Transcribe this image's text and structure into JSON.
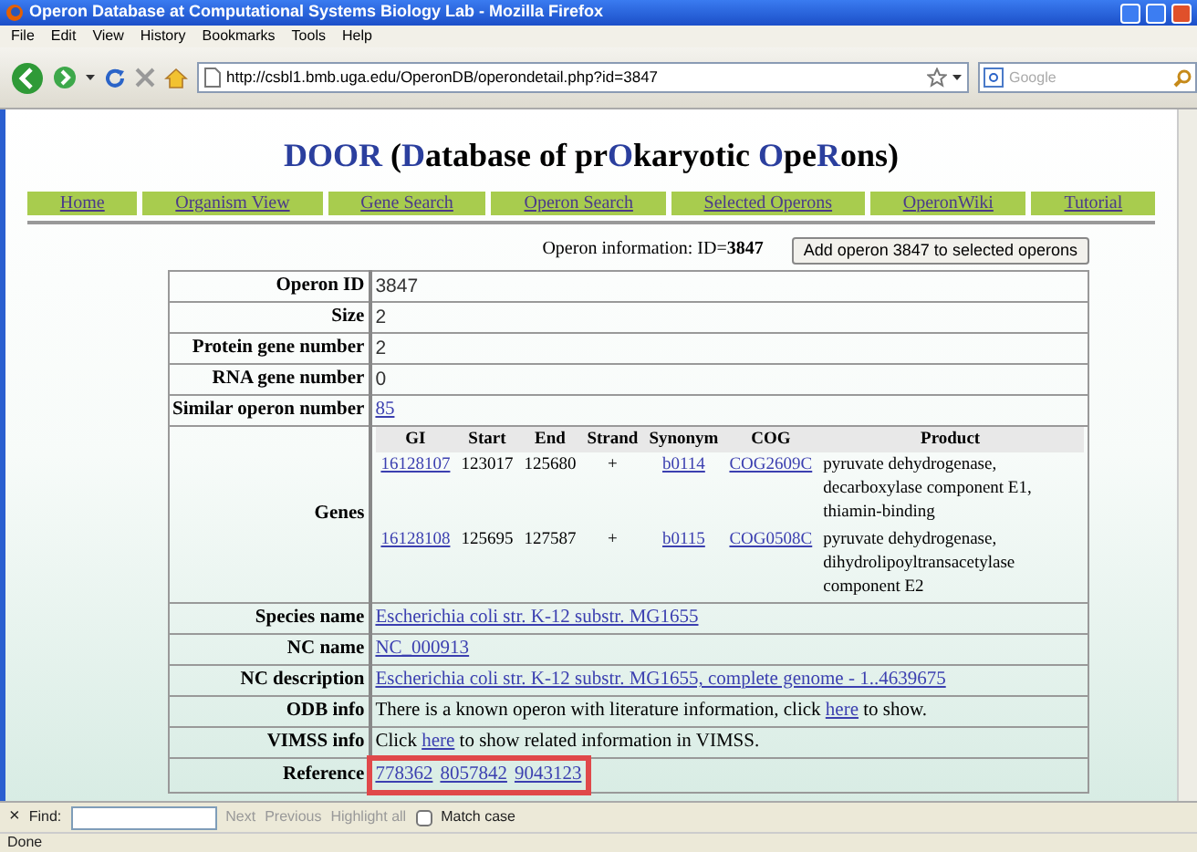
{
  "window": {
    "title": "Operon Database at Computational Systems Biology Lab - Mozilla Firefox"
  },
  "menu": [
    "File",
    "Edit",
    "View",
    "History",
    "Bookmarks",
    "Tools",
    "Help"
  ],
  "address": {
    "value": "http://csbl1.bmb.uga.edu/OperonDB/operondetail.php?id=3847"
  },
  "search": {
    "placeholder": "Google"
  },
  "heading": [
    {
      "text": "DOOR",
      "accent": true
    },
    {
      "text": " (",
      "accent": false
    },
    {
      "text": "D",
      "accent": true
    },
    {
      "text": "atabase of pr",
      "accent": false
    },
    {
      "text": "O",
      "accent": true
    },
    {
      "text": "karyotic ",
      "accent": false
    },
    {
      "text": "O",
      "accent": true
    },
    {
      "text": "pe",
      "accent": false
    },
    {
      "text": "R",
      "accent": true
    },
    {
      "text": "ons)",
      "accent": false
    }
  ],
  "nav": [
    "Home",
    "Organism View",
    "Gene Search",
    "Operon Search",
    "Selected Operons",
    "OperonWiki",
    "Tutorial"
  ],
  "info": {
    "text": "Operon information: ID=**3847**",
    "button": "Add operon 3847 to selected operons"
  },
  "rows": [
    {
      "kind": "value",
      "label": "Operon ID",
      "parts": [
        {
          "text": "3847",
          "link": false
        }
      ]
    },
    {
      "kind": "value",
      "label": "Size",
      "parts": [
        {
          "text": "2",
          "link": false
        }
      ]
    },
    {
      "kind": "value",
      "label": "Protein gene number",
      "parts": [
        {
          "text": "2",
          "link": false
        }
      ]
    },
    {
      "kind": "value",
      "label": "RNA gene number",
      "parts": [
        {
          "text": "0",
          "link": false
        }
      ]
    },
    {
      "kind": "value",
      "label": "Similar operon number",
      "parts": [
        {
          "text": "85",
          "link": true
        }
      ]
    },
    {
      "kind": "genes",
      "label": "Genes",
      "columns": [
        "GI",
        "Start",
        "End",
        "Strand",
        "Synonym",
        "COG",
        "Product"
      ],
      "genes": [
        {
          "gi": "16128107",
          "start": "123017",
          "end": "125680",
          "strand": "+",
          "synonym": "b0114",
          "cog": "COG2609C",
          "product": "pyruvate dehydrogenase, decarboxylase component E1, thiamin-binding"
        },
        {
          "gi": "16128108",
          "start": "125695",
          "end": "127587",
          "strand": "+",
          "synonym": "b0115",
          "cog": "COG0508C",
          "product": "pyruvate dehydrogenase, dihydrolipoyltransacetylase component E2"
        }
      ]
    },
    {
      "kind": "value",
      "label": "Species name",
      "parts": [
        {
          "text": "Escherichia coli str. K-12 substr. MG1655",
          "link": true
        }
      ]
    },
    {
      "kind": "value",
      "label": "NC name",
      "parts": [
        {
          "text": "NC_000913",
          "link": true
        }
      ]
    },
    {
      "kind": "value",
      "label": "NC description",
      "parts": [
        {
          "text": "Escherichia coli str. K-12 substr. MG1655, complete genome - 1..4639675",
          "link": true
        }
      ]
    },
    {
      "kind": "sentence",
      "label": "ODB info",
      "parts": [
        {
          "text": "There is a known operon with literature information, click ",
          "link": false
        },
        {
          "text": "here",
          "link": true
        },
        {
          "text": " to show.",
          "link": false
        }
      ]
    },
    {
      "kind": "sentence",
      "label": "VIMSS info",
      "parts": [
        {
          "text": "Click ",
          "link": false
        },
        {
          "text": "here",
          "link": true
        },
        {
          "text": " to show related information in VIMSS.",
          "link": false
        }
      ]
    },
    {
      "kind": "value",
      "label": "Reference",
      "highlight": true,
      "parts": [
        {
          "text": "778362",
          "link": true
        },
        {
          "text": "8057842",
          "link": true
        },
        {
          "text": "9043123",
          "link": true
        }
      ]
    }
  ],
  "find": {
    "close": "×",
    "label": "Find:",
    "buttons": [
      "Next",
      "Previous",
      "Highlight all"
    ],
    "match_case": {
      "label": "Match case",
      "checked": false
    }
  },
  "status": "Done"
}
